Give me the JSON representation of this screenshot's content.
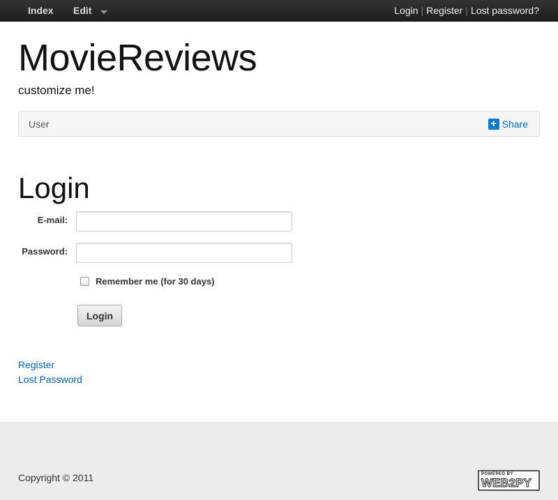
{
  "navbar": {
    "index_label": "Index",
    "edit_label": "Edit",
    "auth_links": {
      "login": "Login",
      "register": "Register",
      "lost_password": "Lost password?",
      "separator": "|"
    }
  },
  "header": {
    "title": "MovieReviews",
    "subtitle": "customize me!"
  },
  "breadcrumb": {
    "current": "User",
    "share_label": "Share",
    "share_icon": "plus-square-icon"
  },
  "login_form": {
    "heading": "Login",
    "email_label": "E-mail:",
    "email_value": "",
    "password_label": "Password:",
    "password_value": "",
    "remember_label": "Remember me (for 30 days)",
    "remember_checked": false,
    "submit_label": "Login"
  },
  "links": {
    "register": "Register",
    "lost_password": "Lost Password"
  },
  "footer": {
    "copyright": "Copyright © 2011",
    "badge_top": "POWERED BY",
    "badge_main": "WEB2PY"
  },
  "colors": {
    "navbar": "#222222",
    "link": "#0066cc",
    "footer_bg": "#ececec"
  }
}
